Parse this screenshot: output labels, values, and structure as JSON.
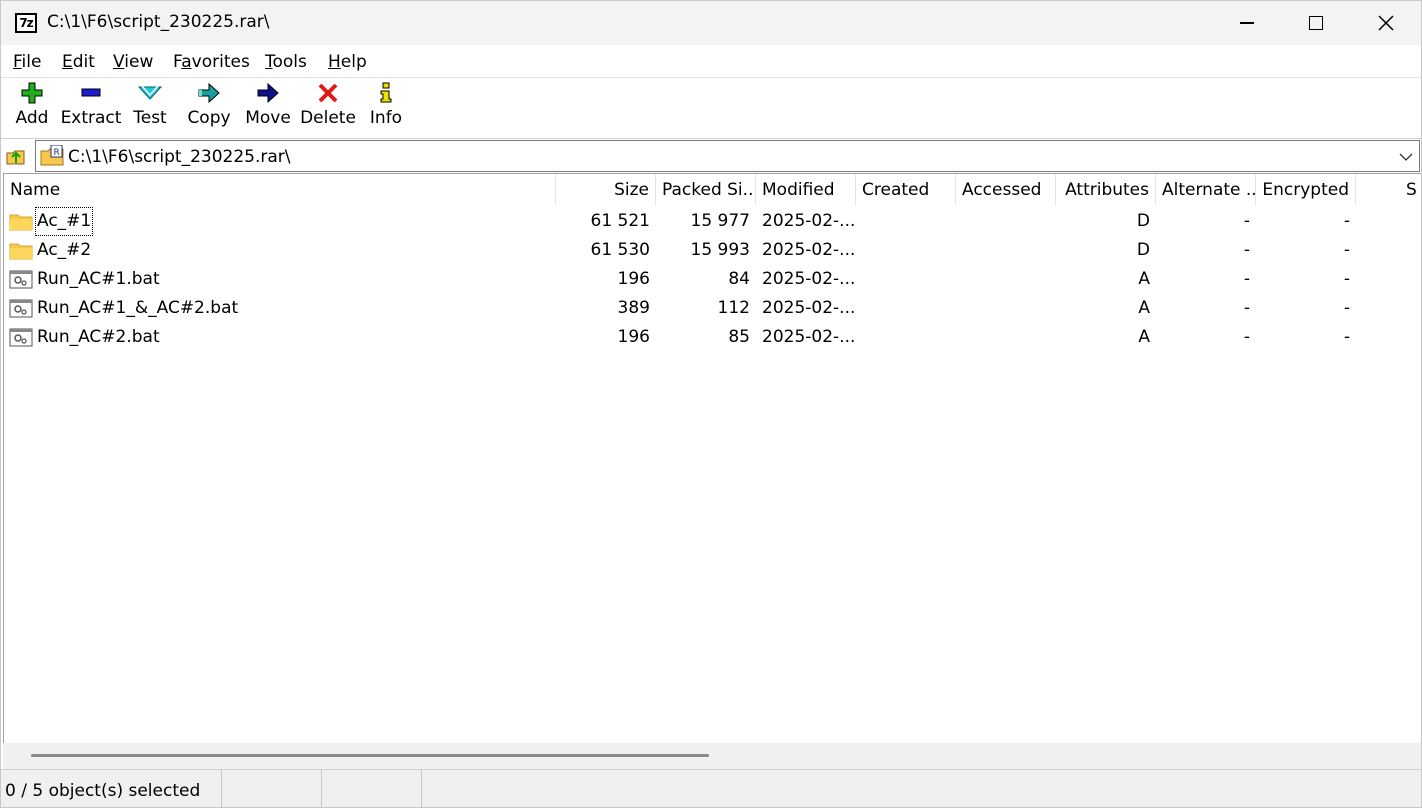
{
  "window": {
    "title": "C:\\1\\F6\\script_230225.rar\\",
    "app_icon_text": "7z"
  },
  "menu": {
    "items": [
      {
        "key": "F",
        "rest": "ile"
      },
      {
        "key": "E",
        "rest": "dit"
      },
      {
        "key": "V",
        "rest": "iew"
      },
      {
        "pre": "F",
        "key": "a",
        "rest": "vorites"
      },
      {
        "key": "T",
        "rest": "ools"
      },
      {
        "key": "H",
        "rest": "elp"
      }
    ]
  },
  "toolbar": {
    "add": "Add",
    "extract": "Extract",
    "test": "Test",
    "copy": "Copy",
    "move": "Move",
    "delete": "Delete",
    "info": "Info"
  },
  "address": {
    "path": "C:\\1\\F6\\script_230225.rar\\"
  },
  "columns": {
    "name": "Name",
    "size": "Size",
    "packed": "Packed Si...",
    "modified": "Modified",
    "created": "Created",
    "accessed": "Accessed",
    "attributes": "Attributes",
    "alternate": "Alternate ...",
    "encrypted": "Encrypted",
    "next": "S"
  },
  "rows": [
    {
      "name": "Ac_#1",
      "type": "folder",
      "size": "61 521",
      "packed": "15 977",
      "modified": "2025-02-...",
      "attributes": "D",
      "alternate": "-",
      "encrypted": "-"
    },
    {
      "name": "Ac_#2",
      "type": "folder",
      "size": "61 530",
      "packed": "15 993",
      "modified": "2025-02-...",
      "attributes": "D",
      "alternate": "-",
      "encrypted": "-"
    },
    {
      "name": "Run_AC#1.bat",
      "type": "bat",
      "size": "196",
      "packed": "84",
      "modified": "2025-02-...",
      "attributes": "A",
      "alternate": "-",
      "encrypted": "-"
    },
    {
      "name": "Run_AC#1_&_AC#2.bat",
      "type": "bat",
      "size": "389",
      "packed": "112",
      "modified": "2025-02-...",
      "attributes": "A",
      "alternate": "-",
      "encrypted": "-"
    },
    {
      "name": "Run_AC#2.bat",
      "type": "bat",
      "size": "196",
      "packed": "85",
      "modified": "2025-02-...",
      "attributes": "A",
      "alternate": "-",
      "encrypted": "-"
    }
  ],
  "status": {
    "selected": "0 / 5 object(s) selected"
  },
  "colors": {
    "add_green": "#1cb01c",
    "extract_blue": "#1c1cd0",
    "test_cyan": "#1ec8e0",
    "copy_teal": "#1aa0a0",
    "move_navy": "#10108a",
    "delete_red": "#e01818",
    "info_yellow": "#f0e000",
    "folder_yellow": "#f8c84a"
  }
}
